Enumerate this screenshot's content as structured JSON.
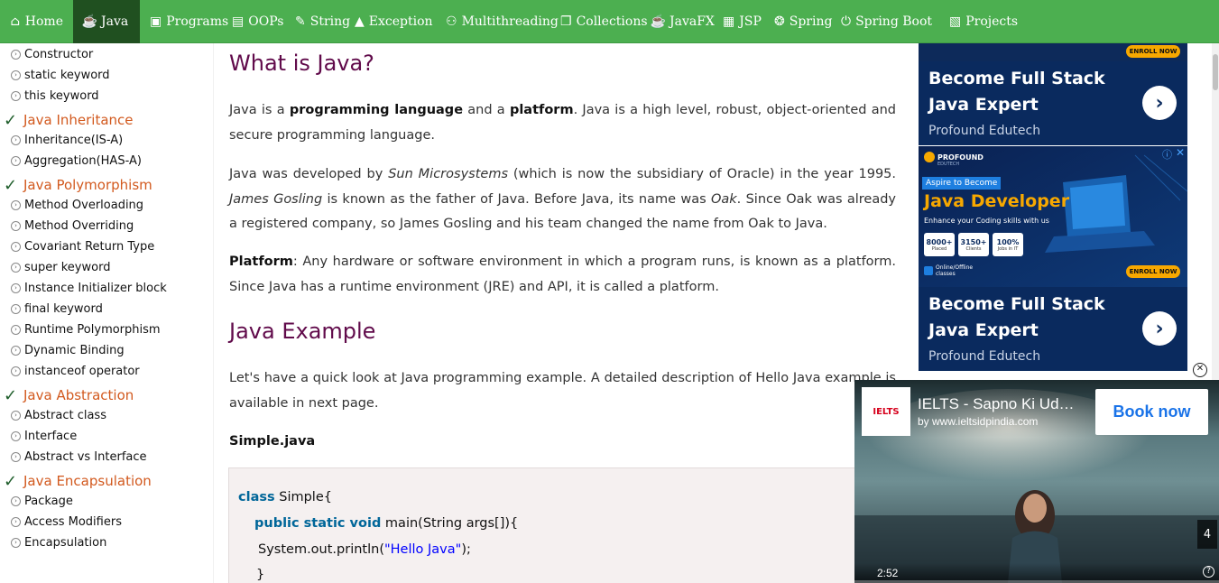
{
  "nav": [
    {
      "label": "Home",
      "icon": "home-icon",
      "glyph": "⌂"
    },
    {
      "label": "Java",
      "icon": "java-cup-icon",
      "glyph": "☕"
    },
    {
      "label": "Programs",
      "icon": "programs-icon",
      "glyph": "▣"
    },
    {
      "label": "OOPs",
      "icon": "oops-icon",
      "glyph": "▤"
    },
    {
      "label": "String",
      "icon": "string-icon",
      "glyph": "✎"
    },
    {
      "label": "Exception",
      "icon": "warning-icon",
      "glyph": "▲"
    },
    {
      "label": "Multithreading",
      "icon": "multithreading-icon",
      "glyph": "⚇"
    },
    {
      "label": "Collections",
      "icon": "collections-icon",
      "glyph": "❐"
    },
    {
      "label": "JavaFX",
      "icon": "javafx-icon",
      "glyph": "☕"
    },
    {
      "label": "JSP",
      "icon": "jsp-icon",
      "glyph": "▦"
    },
    {
      "label": "Spring",
      "icon": "spring-icon",
      "glyph": "❂"
    },
    {
      "label": "Spring Boot",
      "icon": "power-icon",
      "glyph": "⏻"
    },
    {
      "label": "Projects",
      "icon": "projects-icon",
      "glyph": "▧"
    }
  ],
  "sidebar": {
    "items": [
      {
        "type": "sub",
        "label": "Constructor"
      },
      {
        "type": "sub",
        "label": "static keyword"
      },
      {
        "type": "sub",
        "label": "this keyword"
      },
      {
        "type": "head",
        "label": "Java Inheritance"
      },
      {
        "type": "sub",
        "label": "Inheritance(IS-A)"
      },
      {
        "type": "sub",
        "label": "Aggregation(HAS-A)"
      },
      {
        "type": "head",
        "label": "Java Polymorphism"
      },
      {
        "type": "sub",
        "label": "Method Overloading"
      },
      {
        "type": "sub",
        "label": "Method Overriding"
      },
      {
        "type": "sub",
        "label": "Covariant Return Type"
      },
      {
        "type": "sub",
        "label": "super keyword"
      },
      {
        "type": "sub",
        "label": "Instance Initializer block"
      },
      {
        "type": "sub",
        "label": "final keyword"
      },
      {
        "type": "sub",
        "label": "Runtime Polymorphism"
      },
      {
        "type": "sub",
        "label": "Dynamic Binding"
      },
      {
        "type": "sub",
        "label": "instanceof operator"
      },
      {
        "type": "head",
        "label": "Java Abstraction"
      },
      {
        "type": "sub",
        "label": "Abstract class"
      },
      {
        "type": "sub",
        "label": "Interface"
      },
      {
        "type": "sub",
        "label": "Abstract vs Interface"
      },
      {
        "type": "head",
        "label": "Java Encapsulation"
      },
      {
        "type": "sub",
        "label": "Package"
      },
      {
        "type": "sub",
        "label": "Access Modifiers"
      },
      {
        "type": "sub",
        "label": "Encapsulation"
      }
    ]
  },
  "main": {
    "heading1": "What is Java?",
    "p1": {
      "a": "Java is a ",
      "b1": "programming language",
      "c": " and a ",
      "b2": "platform",
      "d": ". Java is a high level, robust, object-oriented and secure programming language."
    },
    "p2": {
      "a": "Java was developed by ",
      "i1": "Sun Microsystems",
      "b": " (which is now the subsidiary of Oracle) in the year 1995. ",
      "i2": "James Gosling",
      "c": " is known as the father of Java. Before Java, its name was ",
      "i3": "Oak",
      "d": ". Since Oak was already a registered company, so James Gosling and his team changed the name from Oak to Java."
    },
    "p3": {
      "b": "Platform",
      "a": ": Any hardware or software environment in which a program runs, is known as a platform. Since Java has a runtime environment (JRE) and API, it is called a platform."
    },
    "heading2": "Java Example",
    "p4": "Let's have a quick look at Java programming example. A detailed description of Hello Java example is available in next page.",
    "file_label": "Simple.java",
    "code": {
      "l1_kw": "class",
      "l1_rest": " Simple{",
      "l2_kw": "public static void",
      "l2_rest": " main(String args[]){",
      "l3_a": "System.out.println(",
      "l3_str": "\"Hello Java\"",
      "l3_b": ");",
      "l4": "}"
    }
  },
  "ads": {
    "text_ad_title": "Become Full Stack Java Expert",
    "text_ad_sub": "Profound Edutech",
    "banner": {
      "brand": "PROFOUND",
      "brand_sub": "EDUTECH",
      "pill": "Aspire to Become",
      "title": "Java Developer",
      "tagline": "Enhance your Coding skills with us",
      "stats": [
        {
          "n": "8000+",
          "t": "Placed"
        },
        {
          "n": "3150+",
          "t": "Clients"
        },
        {
          "n": "100%",
          "t": "Jobs in IT"
        }
      ],
      "mode": "Online/Offline",
      "mode_sub": "classes",
      "enroll": "ENROLL NOW"
    },
    "text_ad2_title": "Become Full Stack Java Expert",
    "text_ad2_sub": "Profound Edutech"
  },
  "video": {
    "title": "IELTS - Sapno Ki Ud…",
    "by": "by www.ieltsidpindia.com",
    "logo": "IELTS",
    "cta": "Book now",
    "time": "2:52",
    "skip": "4"
  }
}
